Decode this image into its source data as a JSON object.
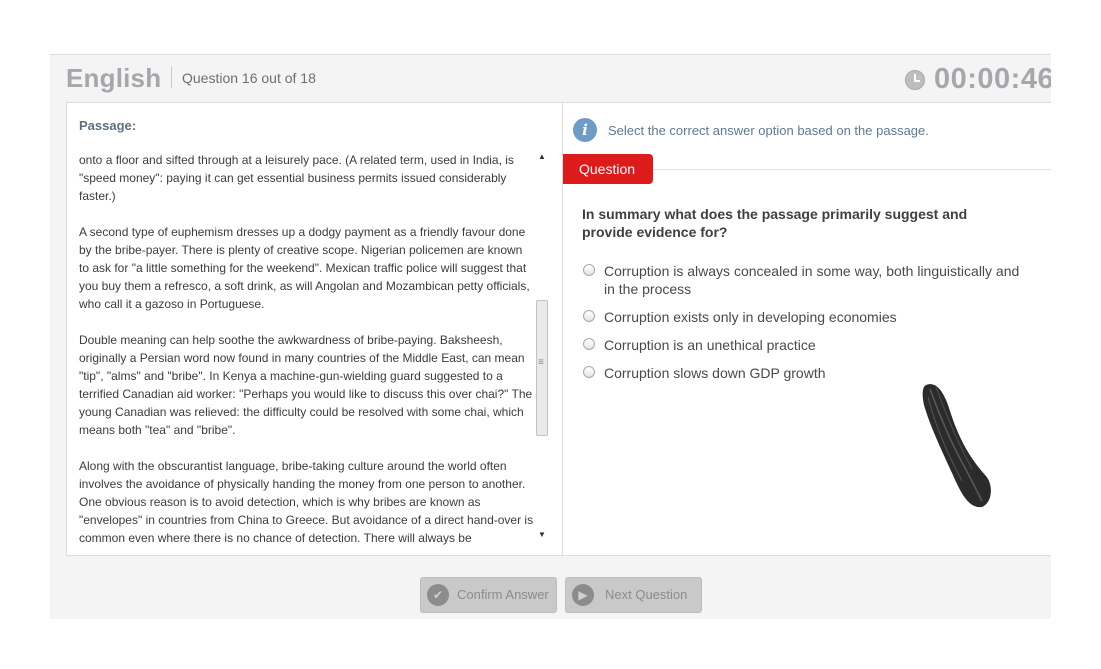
{
  "header": {
    "subject": "English",
    "progress": "Question 16 out of 18",
    "timer": "00:00:46",
    "timer_icon": "clock-icon"
  },
  "passage": {
    "title": "Passage:",
    "paragraphs": [
      "onto a floor and sifted through at a leisurely pace. (A related term, used in India, is \"speed money\": paying it can get essential business permits issued considerably faster.)",
      "A second type of euphemism dresses up a dodgy payment as a friendly favour done by the bribe-payer. There is plenty of creative scope. Nigerian policemen are known to ask for \"a little something for the weekend\". Mexican traffic police will suggest that you buy them a refresco, a soft drink, as will Angolan and Mozambican petty officials, who call it a gazoso in Portuguese.",
      "Double meaning can help soothe the awkwardness of bribe-paying. Baksheesh, originally a Persian word now found in many countries of the Middle East, can mean \"tip\", \"alms\" and \"bribe\". In Kenya a machine-gun-wielding guard suggested to a terrified Canadian aid worker: \"Perhaps you would like to discuss this over chai?\" The young Canadian was relieved: the difficulty could be resolved with some chai, which means both \"tea\" and \"bribe\".",
      "Along with the obscurantist language, bribe-taking culture around the world often involves the avoidance of physically handing the money from one person to another. One obvious reason is to avoid detection, which is why bribes are known as \"envelopes\" in countries from China to Greece. But avoidance of a direct hand-over is common even where there is no chance of detection. There will always be"
    ]
  },
  "question_panel": {
    "info_icon": "info-icon",
    "instruction": "Select the correct answer option based on the passage.",
    "tab_label": "Question",
    "question": "In summary what does the passage primarily suggest and provide evidence for?",
    "options": [
      "Corruption is always concealed in some way, both linguistically and in the process",
      "Corruption exists only in developing economies",
      "Corruption is an unethical practice",
      "Corruption slows down GDP growth"
    ]
  },
  "buttons": {
    "confirm": "Confirm Answer",
    "next": "Next Question"
  },
  "colors": {
    "tab_red": "#dd1b1b",
    "info_blue": "#6f9bc7",
    "header_gray": "#a4a7ab"
  }
}
